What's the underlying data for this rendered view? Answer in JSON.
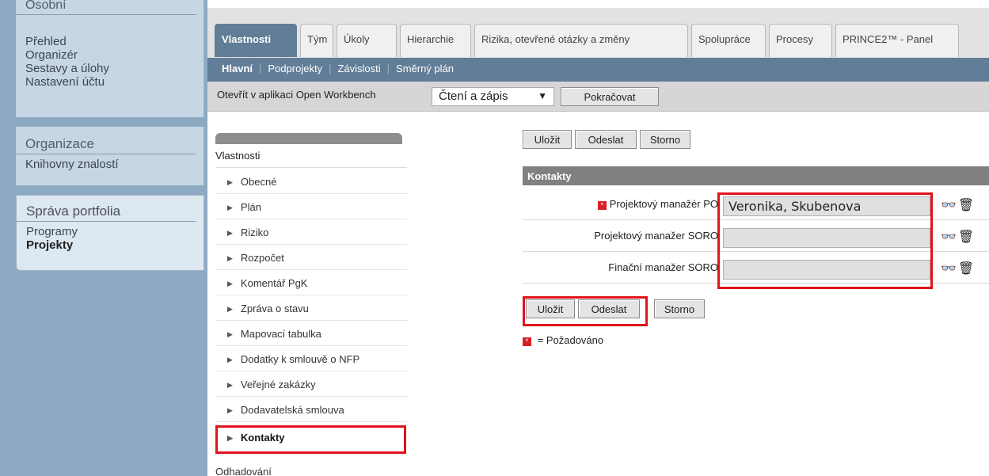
{
  "sidebar": {
    "osobni": {
      "heading": "Osobní",
      "items": [
        "Přehled",
        "Organizér",
        "Sestavy a úlohy",
        "Nastavení účtu"
      ]
    },
    "organizace": {
      "heading": "Organizace",
      "items": [
        "Knihovny znalostí"
      ]
    },
    "sprava": {
      "heading": "Správa portfolia",
      "items": [
        "Programy",
        "Projekty"
      ]
    }
  },
  "tabs": [
    "Vlastnosti",
    "Tým",
    "Úkoly",
    "Hierarchie",
    "Rizika, otevřené otázky a změny",
    "Spolupráce",
    "Procesy",
    "PRINCE2™ - Panel"
  ],
  "subnav": [
    "Hlavní",
    "Podprojekty",
    "Závislosti",
    "Směrný plán"
  ],
  "toolbar": {
    "open_label": "Otevřít v aplikaci Open Workbench",
    "mode_value": "Čtení a zápis",
    "continue_button": "Pokračovat"
  },
  "propnav": {
    "title": "Vlastnosti",
    "items": [
      "Obecné",
      "Plán",
      "Riziko",
      "Rozpočet",
      "Komentář PgK",
      "Zpráva o stavu",
      "Mapovací tabulka",
      "Dodatky k smlouvě o NFP",
      "Veřejné zakázky",
      "Dodavatelská smlouva",
      "Kontakty"
    ],
    "bottom": "Odhadování"
  },
  "buttons": {
    "save": "Uložit",
    "submit": "Odeslat",
    "cancel": "Storno"
  },
  "contacts": {
    "heading": "Kontakty",
    "fields": [
      {
        "label": "Projektový manažér PO",
        "value": "Veronika, Skubenova",
        "required": true
      },
      {
        "label": "Projektový manažer SORO",
        "value": "",
        "required": false
      },
      {
        "label": "Finační manažer SORO",
        "value": "",
        "required": false
      }
    ]
  },
  "legend": "= Požadováno"
}
